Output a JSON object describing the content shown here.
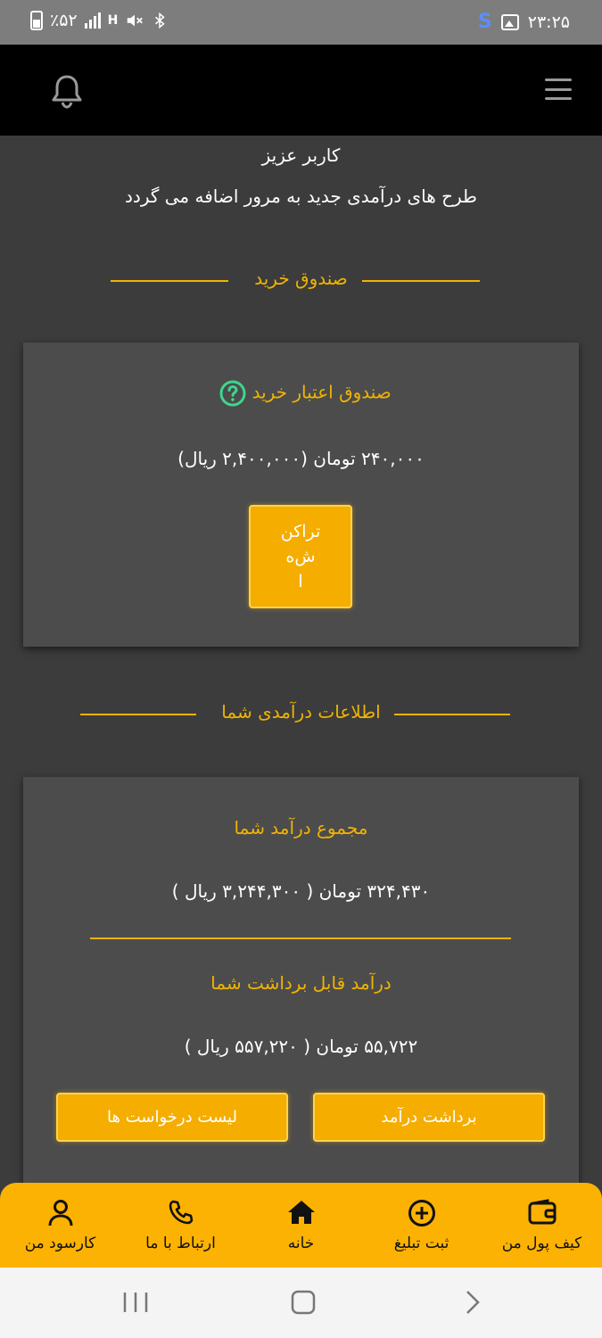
{
  "status_bar": {
    "time": "۲۳:۲۵",
    "battery": "٪۵۲",
    "network": "H"
  },
  "greeting": {
    "title": "کاربر عزیز",
    "subtitle": "طرح های درآمدی جدید به مرور اضافه می گردد"
  },
  "purchase_section": {
    "heading": "صندوق خرید",
    "card_title": "صندوق اعتبار خرید",
    "amount": "۲۴۰,۰۰۰ تومان (۲,۴۰۰,۰۰۰ ریال)",
    "transactions_label_1": "تراکن",
    "transactions_label_2": "ش‌ه",
    "transactions_label_3": "ا"
  },
  "income_section": {
    "heading": "اطلاعات درآمدی شما",
    "total_title": "مجموع درآمد شما",
    "total_amount": "۳۲۴,۴۳۰ تومان ( ۳,۲۴۴,۳۰۰ ریال )",
    "withdrawable_title": "درآمد قابل برداشت شما",
    "withdrawable_amount": "۵۵,۷۲۲ تومان ( ۵۵۷,۲۲۰ ریال )",
    "withdraw_button": "برداشت درآمد",
    "requests_button": "لیست درخواست ها"
  },
  "bottom_nav": {
    "wallet": "کیف پول من",
    "add_ad": "ثبت تبلیغ",
    "home": "خانه",
    "contact": "ارتباط با ما",
    "profile": "کارسود من"
  },
  "colors": {
    "accent": "#f0b400",
    "nav_bg": "#fcb202",
    "card_bg": "#4c4c4c",
    "page_bg": "#3c3c3c",
    "help_green": "#3dd68c"
  }
}
